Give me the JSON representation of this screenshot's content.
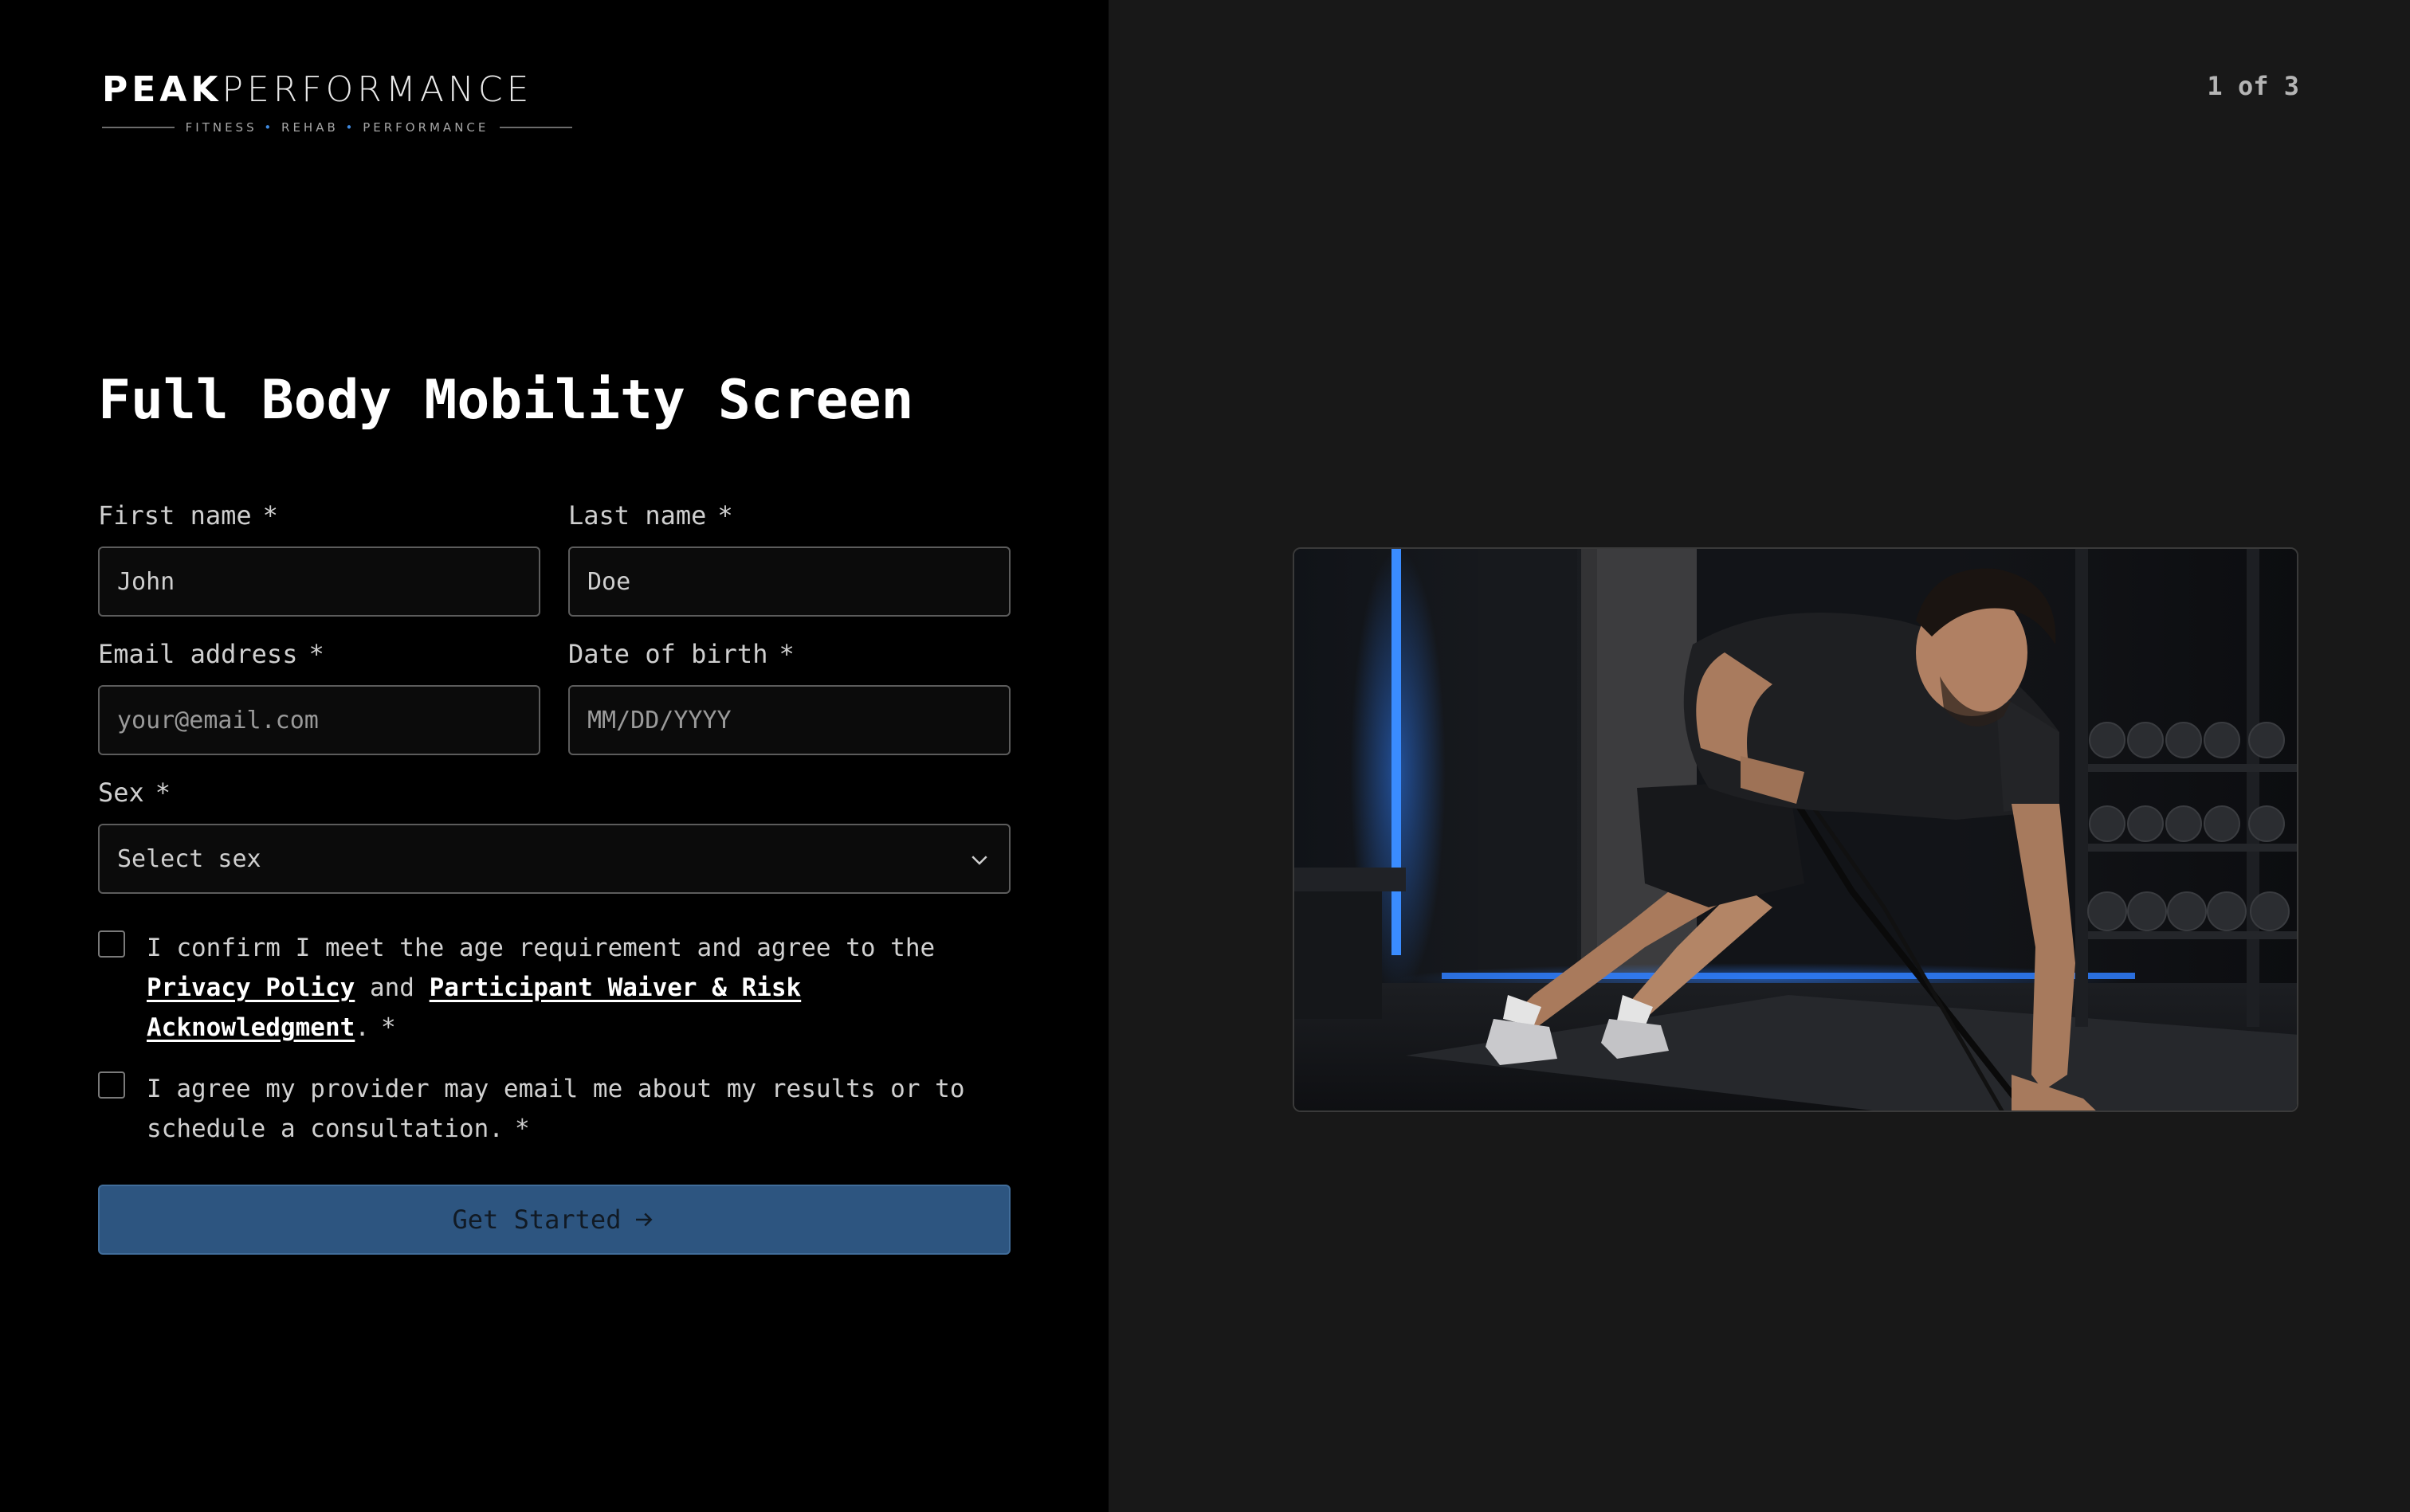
{
  "brand": {
    "name_bold": "PEAK",
    "name_light": "PERFORMANCE",
    "tagline": [
      "FITNESS",
      "REHAB",
      "PERFORMANCE"
    ],
    "tagline_separator": "•"
  },
  "progress": {
    "label": "1 of 3",
    "current": 1,
    "total": 3
  },
  "form": {
    "title": "Full Body Mobility Screen",
    "required_mark": "*",
    "first_name": {
      "label": "First name",
      "value": "John",
      "placeholder": ""
    },
    "last_name": {
      "label": "Last name",
      "value": "Doe",
      "placeholder": ""
    },
    "email": {
      "label": "Email address",
      "value": "",
      "placeholder": "your@email.com"
    },
    "dob": {
      "label": "Date of birth",
      "value": "",
      "placeholder": "MM/DD/YYYY"
    },
    "sex": {
      "label": "Sex",
      "selected": "Select sex"
    },
    "consent_terms": {
      "checked": false,
      "text_before": "I confirm I meet the age requirement and agree to the ",
      "link_privacy": "Privacy Policy",
      "text_middle": " and ",
      "link_waiver": "Participant Waiver & Risk Acknowledgment",
      "text_after": "."
    },
    "consent_email": {
      "checked": false,
      "text": "I agree my provider may email me about my results or to schedule a consultation."
    },
    "submit_label": "Get Started"
  },
  "icons": {
    "select": "chevron-down-icon",
    "submit": "arrow-right-icon"
  },
  "colors": {
    "left_panel": "#000000",
    "right_panel": "#181818",
    "accent_button": "#2d5580",
    "logo_dot": "#3f8ae0",
    "neon_light": "#2f7fff"
  }
}
